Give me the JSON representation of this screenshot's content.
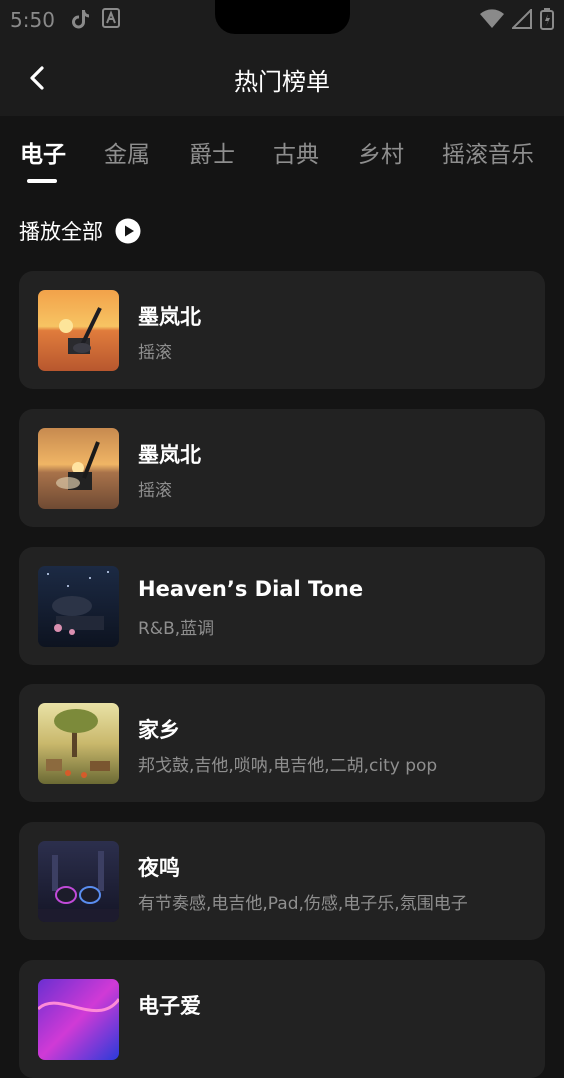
{
  "status_bar": {
    "time": "5:50"
  },
  "header": {
    "title": "热门榜单",
    "back_icon": "chevron-left-icon"
  },
  "tabs": [
    {
      "label": "电子",
      "active": true
    },
    {
      "label": "金属",
      "active": false
    },
    {
      "label": "爵士",
      "active": false
    },
    {
      "label": "古典",
      "active": false
    },
    {
      "label": "乡村",
      "active": false
    },
    {
      "label": "摇滚音乐",
      "active": false
    }
  ],
  "play_all": {
    "label": "播放全部",
    "icon": "play-circle-icon"
  },
  "songs": [
    {
      "title": "墨岚北",
      "tags": "摇滚"
    },
    {
      "title": "墨岚北",
      "tags": "摇滚"
    },
    {
      "title": "Heaven’s Dial Tone",
      "tags": "R&B,蓝调"
    },
    {
      "title": "家乡",
      "tags": "邦戈鼓,吉他,唢呐,电吉他,二胡,city pop"
    },
    {
      "title": "夜鸣",
      "tags": "有节奏感,电吉他,Pad,伤感,电子乐,氛围电子"
    },
    {
      "title": "电子爱",
      "tags": ""
    }
  ],
  "colors": {
    "background": "#141414",
    "card": "#222222",
    "accent": "#ffffff",
    "muted": "#8f8f8f"
  }
}
